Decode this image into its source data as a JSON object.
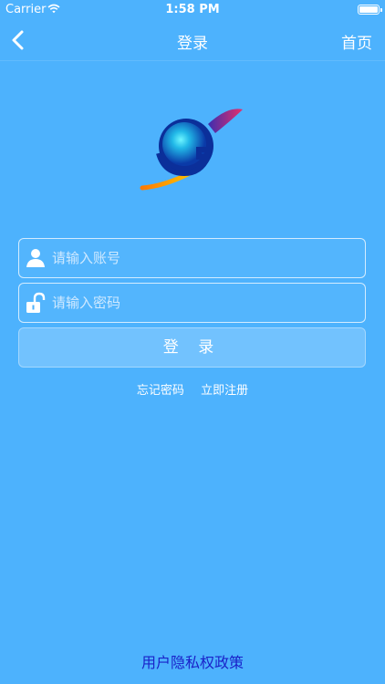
{
  "status_bar": {
    "carrier": "Carrier",
    "time": "1:58 PM"
  },
  "nav": {
    "title": "登录",
    "home_label": "首页"
  },
  "form": {
    "username_placeholder": "请输入账号",
    "password_placeholder": "请输入密码",
    "login_label": "登 录"
  },
  "links": {
    "forgot_password": "忘记密码",
    "register": "立即注册"
  },
  "footer": {
    "privacy_policy": "用户隐私权政策"
  },
  "icons": {
    "back": "chevron-left-icon",
    "user": "user-icon",
    "lock": "unlock-icon",
    "wifi": "wifi-icon",
    "battery": "battery-icon"
  },
  "colors": {
    "background": "#4db2fd",
    "privacy_link": "#1a22c9"
  }
}
